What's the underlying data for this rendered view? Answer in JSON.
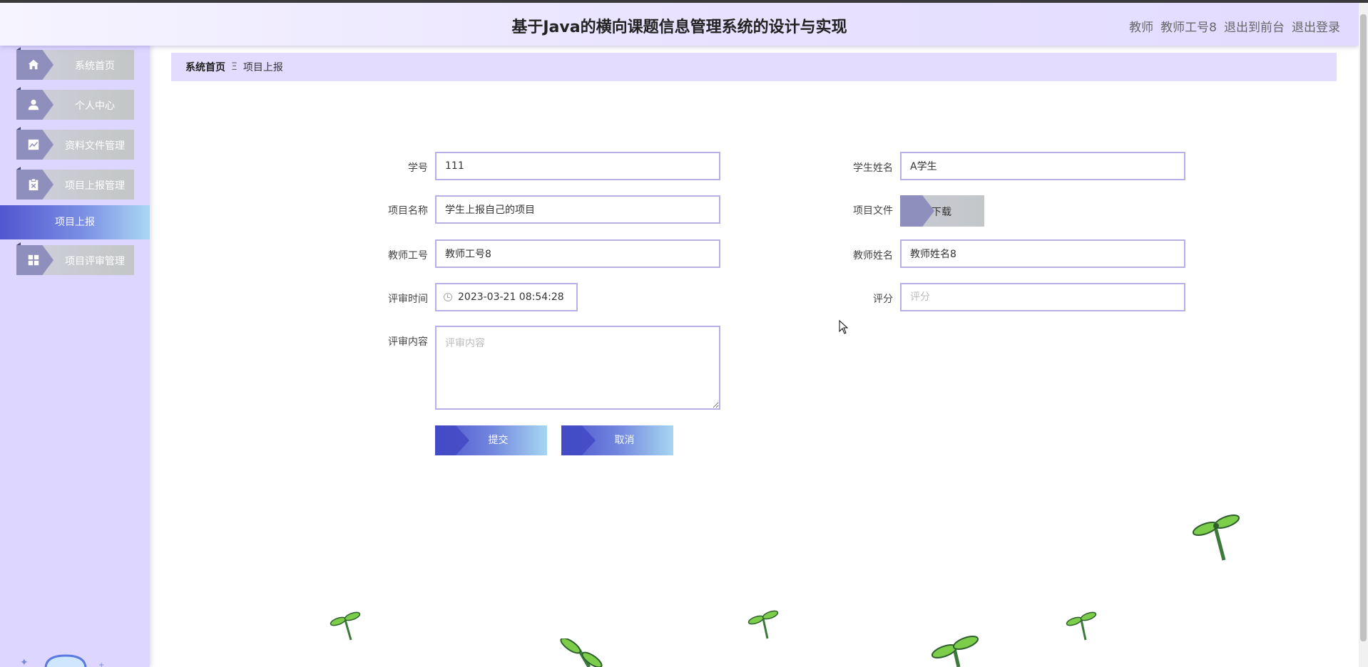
{
  "header": {
    "title": "基于Java的横向课题信息管理系统的设计与实现",
    "role": "教师",
    "username": "教师工号8",
    "to_front": "退出到前台",
    "logout": "退出登录"
  },
  "sidebar": {
    "items": [
      {
        "label": "系统首页",
        "icon": "home-icon"
      },
      {
        "label": "个人中心",
        "icon": "user-icon"
      },
      {
        "label": "资料文件管理",
        "icon": "chart-icon"
      },
      {
        "label": "项目上报管理",
        "icon": "clipboard-icon"
      },
      {
        "label": "项目评审管理",
        "icon": "grid-icon"
      }
    ],
    "active_sub": "项目上报"
  },
  "breadcrumb": {
    "home": "系统首页",
    "separator": "Ξ",
    "current": "项目上报"
  },
  "form": {
    "student_no": {
      "label": "学号",
      "value": "111"
    },
    "student_name": {
      "label": "学生姓名",
      "value": "A学生"
    },
    "project_name": {
      "label": "项目名称",
      "value": "学生上报自己的项目"
    },
    "project_file": {
      "label": "项目文件",
      "button": "下载"
    },
    "teacher_no": {
      "label": "教师工号",
      "value": "教师工号8"
    },
    "teacher_name": {
      "label": "教师姓名",
      "value": "教师姓名8"
    },
    "review_time": {
      "label": "评审时间",
      "value": "2023-03-21 08:54:28"
    },
    "score": {
      "label": "评分",
      "placeholder": "评分"
    },
    "review_content": {
      "label": "评审内容",
      "placeholder": "评审内容"
    },
    "submit": "提交",
    "cancel": "取消"
  },
  "colors": {
    "accent": "#5056cf",
    "sidebar_bg": "#ddd6ff",
    "breadcrumb_bg": "#e3dcff",
    "input_border": "#b6b0e6"
  }
}
